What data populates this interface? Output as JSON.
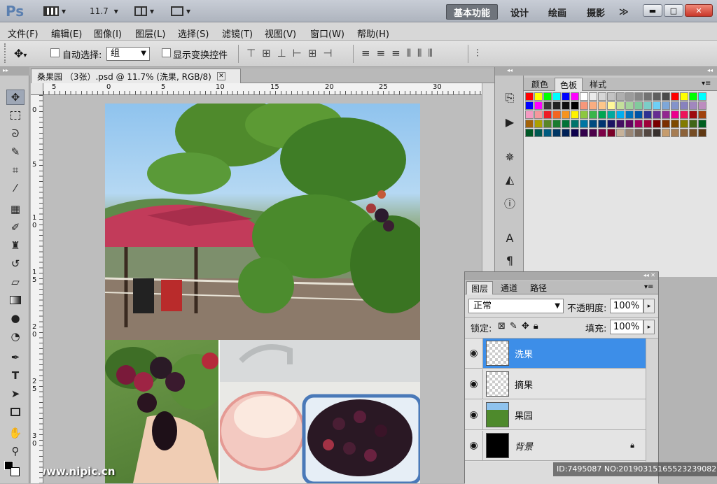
{
  "app": {
    "logo": "Ps",
    "zoom": "11.7",
    "workspaces": [
      "基本功能",
      "设计",
      "绘画",
      "摄影"
    ],
    "more": "≫",
    "window_buttons": {
      "minimize": "▬",
      "restore": "□",
      "close": "✕"
    }
  },
  "menu": [
    "文件(F)",
    "编辑(E)",
    "图像(I)",
    "图层(L)",
    "选择(S)",
    "滤镜(T)",
    "视图(V)",
    "窗口(W)",
    "帮助(H)"
  ],
  "options": {
    "auto_select_label": "自动选择:",
    "auto_select_value": "组",
    "transform_label": "显示变换控件"
  },
  "document": {
    "tab_title": "桑果园 （3张）.psd @ 11.7% (洗果, RGB/8)",
    "close": "✕"
  },
  "ruler": {
    "top_labels": [
      "5",
      "0",
      "5",
      "10",
      "15",
      "20",
      "25",
      "30"
    ],
    "left_labels": [
      "0",
      "5",
      "1 0",
      "1 5",
      "2 0",
      "2 5",
      "3 0"
    ]
  },
  "swatches": {
    "tabs": [
      "颜色",
      "色板",
      "样式"
    ],
    "active_tab": "色板",
    "colors": [
      [
        "#ff0000",
        "#ffff00",
        "#00ff00",
        "#00ffff",
        "#0000ff",
        "#ff00ff",
        "#ffffff",
        "#ebebeb",
        "#d7d7d7",
        "#c3c3c3",
        "#afafaf",
        "#9b9b9b",
        "#878787",
        "#737373",
        "#5f5f5f",
        "#4b4b4b",
        "#ff0000",
        "#ffff00",
        "#00ff00",
        "#00ffff"
      ],
      [
        "#0000ff",
        "#ff00ff",
        "#373737",
        "#232323",
        "#0f0f0f",
        "#000000",
        "#f7977a",
        "#f9ad81",
        "#fdc68a",
        "#fff79a",
        "#c4df9b",
        "#a2d39c",
        "#82ca9d",
        "#7bcdc8",
        "#6ecff6",
        "#7ea7d8",
        "#8493ca",
        "#8882be",
        "#a187be",
        "#bc8dbf"
      ],
      [
        "#f49ac2",
        "#f6989d",
        "#ed1c24",
        "#f26522",
        "#f7941d",
        "#fff200",
        "#8dc73f",
        "#39b54a",
        "#00a651",
        "#00a99d",
        "#00aeef",
        "#0072bc",
        "#0054a6",
        "#2e3192",
        "#662d91",
        "#92278f",
        "#ec008c",
        "#ed145b",
        "#9e0b0f",
        "#a0410d"
      ],
      [
        "#a36209",
        "#aba000",
        "#598527",
        "#1a7b30",
        "#007236",
        "#00746b",
        "#0076a3",
        "#004b80",
        "#003471",
        "#1b1464",
        "#440e62",
        "#630460",
        "#9e005d",
        "#9e0039",
        "#790000",
        "#7b2e00",
        "#7d4900",
        "#827b00",
        "#406618",
        "#005e20"
      ],
      [
        "#005826",
        "#005952",
        "#005b7f",
        "#003663",
        "#002157",
        "#0d004c",
        "#32004b",
        "#4b0049",
        "#7b0046",
        "#7a0026",
        "#c7b299",
        "#998675",
        "#736357",
        "#534741",
        "#37302d",
        "#c69c6d",
        "#a67c52",
        "#8c6239",
        "#754c24",
        "#603913"
      ]
    ]
  },
  "layers": {
    "tabs": [
      "图层",
      "通道",
      "路径"
    ],
    "active_tab": "图层",
    "blend_mode": "正常",
    "opacity_label": "不透明度:",
    "opacity": "100%",
    "lock_label": "锁定:",
    "fill_label": "填充:",
    "fill": "100%",
    "items": [
      {
        "name": "洗果",
        "selected": true
      },
      {
        "name": "摘果",
        "selected": false
      },
      {
        "name": "果园",
        "selected": false
      },
      {
        "name": "背景",
        "selected": false
      }
    ]
  },
  "watermark": {
    "site": "昵享网 www.nipic.cn",
    "id": "ID:7495087 NO:20190315165523239082"
  }
}
